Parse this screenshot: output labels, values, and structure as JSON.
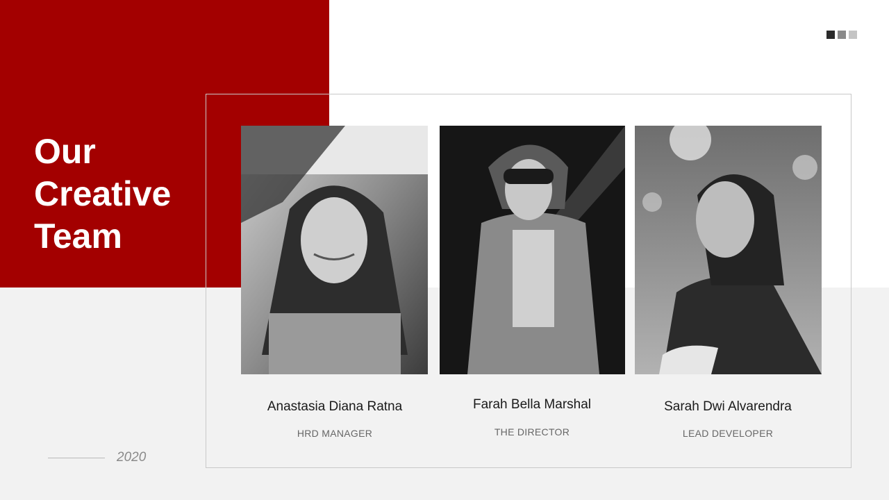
{
  "title": {
    "lines": [
      "Our",
      "Creative",
      "Team"
    ]
  },
  "year": "2020",
  "colors": {
    "accent": "#a30000",
    "dot_dark": "#2b2b2b",
    "dot_mid": "#8a8a8a",
    "dot_light": "#c4c4c4"
  },
  "team": [
    {
      "name": "Anastasia Diana Ratna",
      "role": "HRD MANAGER"
    },
    {
      "name": "Farah Bella Marshal",
      "role": "THE DIRECTOR"
    },
    {
      "name": "Sarah Dwi Alvarendra",
      "role": "LEAD DEVELOPER"
    }
  ]
}
